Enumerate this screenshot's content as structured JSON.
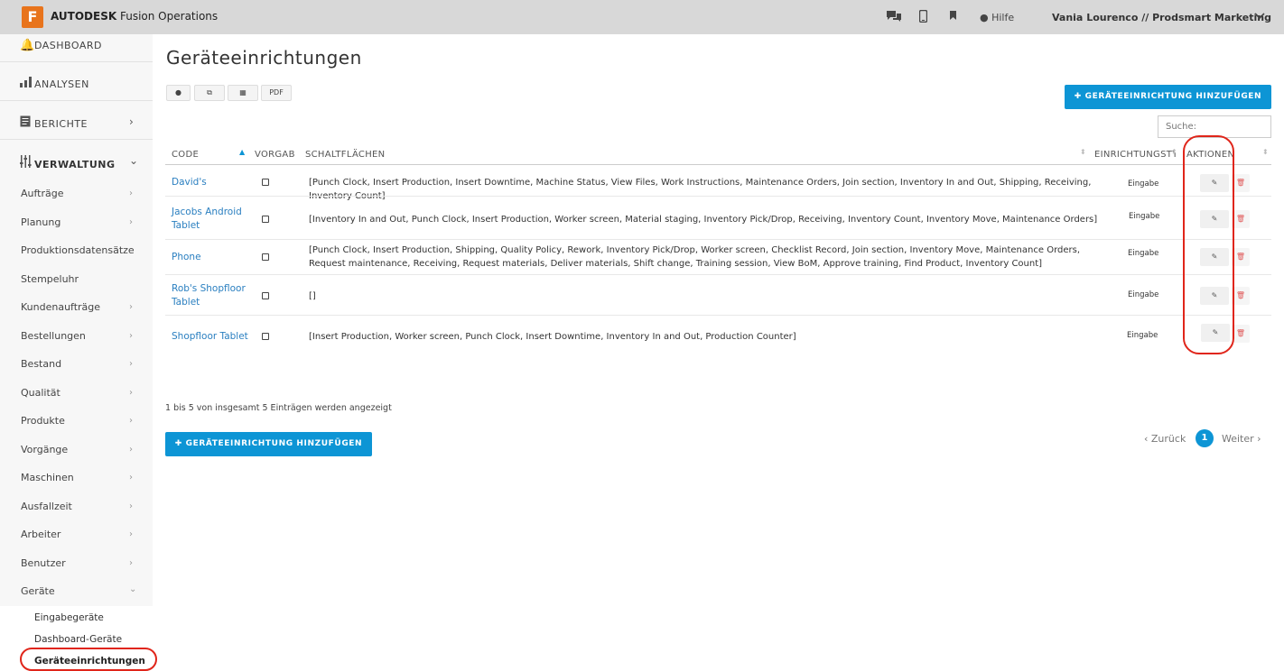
{
  "topbar": {
    "logo_letter": "F",
    "brand_bold": "AUTODESK",
    "brand_rest": "Fusion Operations",
    "icons": [
      "chat-icon",
      "mobile-icon",
      "bookmark-icon",
      "help-icon"
    ],
    "help_label": "Hilfe",
    "user_label": "Vania Lourenco // Prodsmart Marketing"
  },
  "sidebar": {
    "dashboard": "DASHBOARD",
    "analysen": "ANALYSEN",
    "berichte": "BERICHTE",
    "verwaltung": "VERWALTUNG",
    "items": [
      "Aufträge",
      "Planung",
      "Produktionsdatensätze",
      "Stempeluhr",
      "Kundenaufträge",
      "Bestellungen",
      "Bestand",
      "Qualität",
      "Produkte",
      "Vorgänge",
      "Maschinen",
      "Ausfallzeit",
      "Arbeiter",
      "Benutzer",
      "Geräte"
    ],
    "sub_items": [
      "Eingabegeräte",
      "Dashboard-Geräte",
      "Geräteeinrichtungen"
    ]
  },
  "main": {
    "title": "Geräteeinrichtungen",
    "toolbar": {
      "pdf_label": "PDF"
    },
    "add_button": "✚ GERÄTEEINRICHTUNG HINZUFÜGEN",
    "search_placeholder": "Suche:",
    "headers": {
      "code": "CODE",
      "vorgabe": "VORGABE",
      "schaltflaechen": "SCHALTFLÄCHEN",
      "einrichtungstyp": "EINRICHTUNGSTYP",
      "aktionen": "AKTIONEN"
    },
    "rows": [
      {
        "code": "David's",
        "buttons": "[Punch Clock, Insert Production, Insert Downtime, Machine Status, View Files, Work Instructions, Maintenance Orders, Join section, Inventory In and Out, Shipping, Receiving, Inventory Count]",
        "type": "Eingabe"
      },
      {
        "code": "Jacobs Android Tablet",
        "buttons": "[Inventory In and Out, Punch Clock, Insert Production, Worker screen, Material staging, Inventory Pick/Drop, Receiving, Inventory Count, Inventory Move, Maintenance Orders]",
        "type": "Eingabe"
      },
      {
        "code": "Phone",
        "buttons": "[Punch Clock, Insert Production, Shipping, Quality Policy, Rework, Inventory Pick/Drop, Worker screen, Checklist Record, Join section, Inventory Move, Maintenance Orders, Request maintenance, Receiving, Request materials, Deliver materials, Shift change, Training session, View BoM, Approve training, Find Product, Inventory Count]",
        "type": "Eingabe"
      },
      {
        "code": "Rob's Shopfloor Tablet",
        "buttons": "[]",
        "type": "Eingabe"
      },
      {
        "code": "Shopfloor Tablet",
        "buttons": "[Insert Production, Worker screen, Punch Clock, Insert Downtime, Inventory In and Out, Production Counter]",
        "type": "Eingabe"
      }
    ],
    "info_text": "1 bis 5 von insgesamt 5 Einträgen werden angezeigt",
    "pager": {
      "prev": "‹ Zurück",
      "page": "1",
      "next": "Weiter ›"
    }
  },
  "colors": {
    "accent": "#0d95d5",
    "link": "#2a7fc0",
    "highlight": "#e0251a",
    "brand_orange": "#e8741c"
  }
}
